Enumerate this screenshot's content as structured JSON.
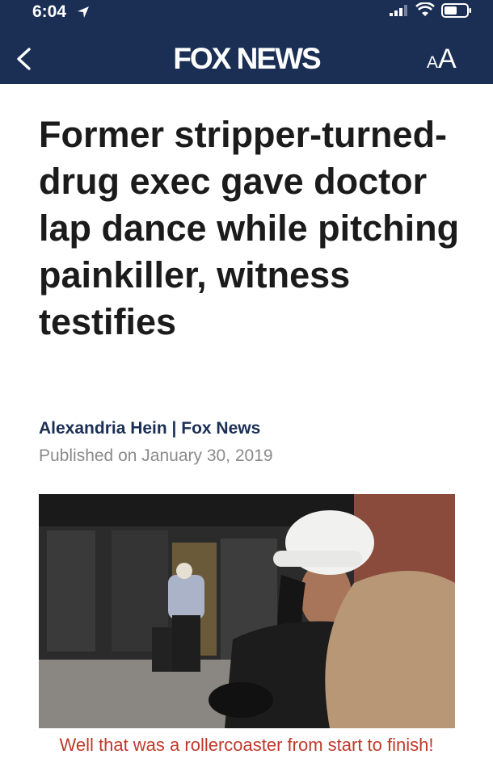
{
  "status_bar": {
    "time": "6:04"
  },
  "header": {
    "brand": "FOX NEWS",
    "text_size_small": "A",
    "text_size_large": "A"
  },
  "article": {
    "headline": "Former stripper-turned-drug exec gave doctor lap dance while pitching painkiller, witness testifies",
    "byline": "Alexandria Hein | Fox News",
    "published_prefix": "Published on",
    "published_date": "January 30, 2019"
  },
  "caption": "Well that was a rollercoaster from start to finish!",
  "colors": {
    "header_bg": "#1b2f55",
    "byline": "#1b2f55",
    "caption": "#c0392b"
  },
  "icons": [
    "location-arrow-icon",
    "signal-icon",
    "wifi-icon",
    "battery-icon",
    "back-chevron-icon"
  ]
}
